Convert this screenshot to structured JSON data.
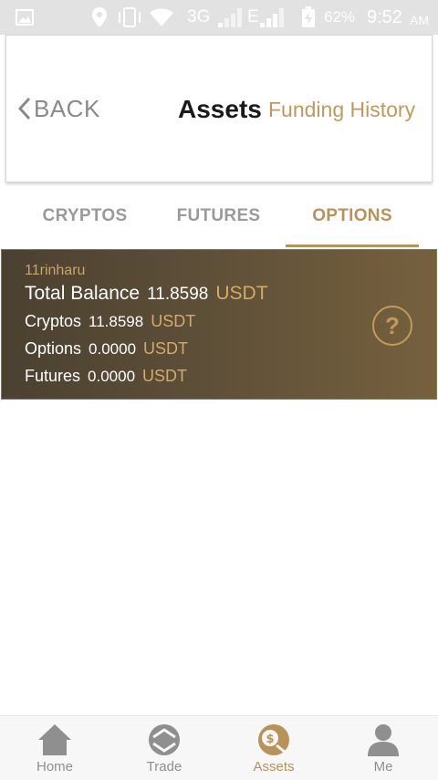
{
  "status_bar": {
    "network": "3G",
    "network2": "E",
    "battery": "62%",
    "time": "9:52",
    "ampm": "AM"
  },
  "header": {
    "back_label": "BACK",
    "title": "Assets",
    "funding_history": "Funding History"
  },
  "tabs": [
    {
      "label": "CRYPTOS",
      "active": false
    },
    {
      "label": "FUTURES",
      "active": false
    },
    {
      "label": "OPTIONS",
      "active": true
    }
  ],
  "balance": {
    "username": "11rinharu",
    "total_label": "Total Balance",
    "total_value": "11.8598",
    "total_currency": "USDT",
    "rows": [
      {
        "label": "Cryptos",
        "value": "11.8598",
        "currency": "USDT"
      },
      {
        "label": "Options",
        "value": "0.0000",
        "currency": "USDT"
      },
      {
        "label": "Futures",
        "value": "0.0000",
        "currency": "USDT"
      }
    ],
    "help_symbol": "?"
  },
  "bottom_nav": [
    {
      "label": "Home",
      "icon": "home-icon",
      "active": false
    },
    {
      "label": "Trade",
      "icon": "trade-icon",
      "active": false
    },
    {
      "label": "Assets",
      "icon": "assets-icon",
      "active": true
    },
    {
      "label": "Me",
      "icon": "person-icon",
      "active": false
    }
  ],
  "colors": {
    "accent": "#b99257",
    "card_gradient_start": "#4b4131",
    "card_gradient_end": "#76613e"
  }
}
